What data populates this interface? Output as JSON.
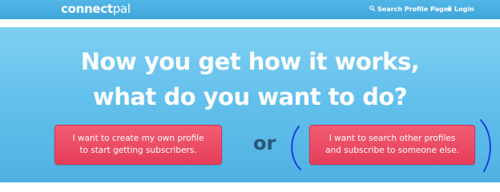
{
  "header": {
    "logo_main": "connect",
    "logo_accent": "pal",
    "search_label": "Search Profile Pages",
    "login_label": "Login",
    "search_icon": "search-icon",
    "login_icon": "lock-icon"
  },
  "hero": {
    "headline_line1": "Now you get how it works,",
    "headline_line2": "what do you want to do?",
    "or_text": "or"
  },
  "actions": {
    "create_line1": "I want to create my own profile",
    "create_line2": "to start getting subscribers.",
    "search_line1": "I want to search other profiles",
    "search_line2": "and subscribe to someone else."
  },
  "colors": {
    "header_blue": "#48aee0",
    "hero_blue": "#64c0ec",
    "button_red": "#e84a63",
    "or_text": "#2a5876",
    "annotation_ink": "#1c3fe0"
  }
}
